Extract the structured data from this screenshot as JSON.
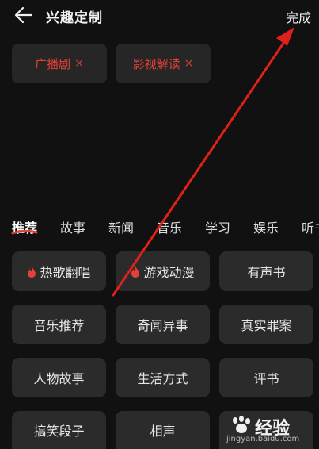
{
  "header": {
    "title": "兴趣定制",
    "done_label": "完成"
  },
  "selected": [
    {
      "label": "广播剧",
      "remove": "×"
    },
    {
      "label": "影视解读",
      "remove": "×"
    }
  ],
  "tabs": [
    "推荐",
    "故事",
    "新闻",
    "音乐",
    "学习",
    "娱乐",
    "听书"
  ],
  "categories": [
    {
      "label": "热歌翻唱",
      "hot": true
    },
    {
      "label": "游戏动漫",
      "hot": true
    },
    {
      "label": "有声书",
      "hot": false
    },
    {
      "label": "音乐推荐",
      "hot": false
    },
    {
      "label": "奇闻异事",
      "hot": false
    },
    {
      "label": "真实罪案",
      "hot": false
    },
    {
      "label": "人物故事",
      "hot": false
    },
    {
      "label": "生活方式",
      "hot": false
    },
    {
      "label": "评书",
      "hot": false
    },
    {
      "label": "搞笑段子",
      "hot": false
    },
    {
      "label": "相声",
      "hot": false
    },
    {
      "label": "",
      "hot": false
    }
  ],
  "watermark": {
    "text": "经验",
    "url": "jingyan.baidu.com"
  },
  "colors": {
    "accent": "#e5403a",
    "background": "#111111",
    "chip": "#2b2b2b",
    "annotation_arrow": "#e0201b"
  }
}
